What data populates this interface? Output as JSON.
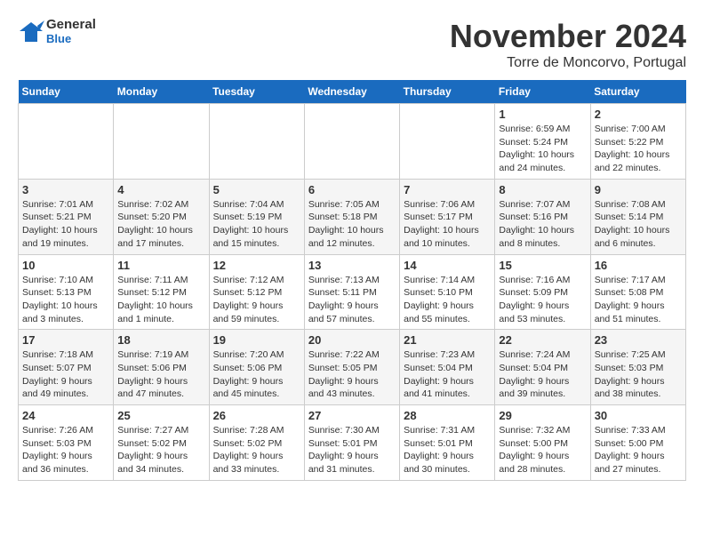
{
  "header": {
    "logo_line1": "General",
    "logo_line2": "Blue",
    "month_title": "November 2024",
    "subtitle": "Torre de Moncorvo, Portugal"
  },
  "weekdays": [
    "Sunday",
    "Monday",
    "Tuesday",
    "Wednesday",
    "Thursday",
    "Friday",
    "Saturday"
  ],
  "weeks": [
    [
      {
        "day": "",
        "info": ""
      },
      {
        "day": "",
        "info": ""
      },
      {
        "day": "",
        "info": ""
      },
      {
        "day": "",
        "info": ""
      },
      {
        "day": "",
        "info": ""
      },
      {
        "day": "1",
        "info": "Sunrise: 6:59 AM\nSunset: 5:24 PM\nDaylight: 10 hours\nand 24 minutes."
      },
      {
        "day": "2",
        "info": "Sunrise: 7:00 AM\nSunset: 5:22 PM\nDaylight: 10 hours\nand 22 minutes."
      }
    ],
    [
      {
        "day": "3",
        "info": "Sunrise: 7:01 AM\nSunset: 5:21 PM\nDaylight: 10 hours\nand 19 minutes."
      },
      {
        "day": "4",
        "info": "Sunrise: 7:02 AM\nSunset: 5:20 PM\nDaylight: 10 hours\nand 17 minutes."
      },
      {
        "day": "5",
        "info": "Sunrise: 7:04 AM\nSunset: 5:19 PM\nDaylight: 10 hours\nand 15 minutes."
      },
      {
        "day": "6",
        "info": "Sunrise: 7:05 AM\nSunset: 5:18 PM\nDaylight: 10 hours\nand 12 minutes."
      },
      {
        "day": "7",
        "info": "Sunrise: 7:06 AM\nSunset: 5:17 PM\nDaylight: 10 hours\nand 10 minutes."
      },
      {
        "day": "8",
        "info": "Sunrise: 7:07 AM\nSunset: 5:16 PM\nDaylight: 10 hours\nand 8 minutes."
      },
      {
        "day": "9",
        "info": "Sunrise: 7:08 AM\nSunset: 5:14 PM\nDaylight: 10 hours\nand 6 minutes."
      }
    ],
    [
      {
        "day": "10",
        "info": "Sunrise: 7:10 AM\nSunset: 5:13 PM\nDaylight: 10 hours\nand 3 minutes."
      },
      {
        "day": "11",
        "info": "Sunrise: 7:11 AM\nSunset: 5:12 PM\nDaylight: 10 hours\nand 1 minute."
      },
      {
        "day": "12",
        "info": "Sunrise: 7:12 AM\nSunset: 5:12 PM\nDaylight: 9 hours\nand 59 minutes."
      },
      {
        "day": "13",
        "info": "Sunrise: 7:13 AM\nSunset: 5:11 PM\nDaylight: 9 hours\nand 57 minutes."
      },
      {
        "day": "14",
        "info": "Sunrise: 7:14 AM\nSunset: 5:10 PM\nDaylight: 9 hours\nand 55 minutes."
      },
      {
        "day": "15",
        "info": "Sunrise: 7:16 AM\nSunset: 5:09 PM\nDaylight: 9 hours\nand 53 minutes."
      },
      {
        "day": "16",
        "info": "Sunrise: 7:17 AM\nSunset: 5:08 PM\nDaylight: 9 hours\nand 51 minutes."
      }
    ],
    [
      {
        "day": "17",
        "info": "Sunrise: 7:18 AM\nSunset: 5:07 PM\nDaylight: 9 hours\nand 49 minutes."
      },
      {
        "day": "18",
        "info": "Sunrise: 7:19 AM\nSunset: 5:06 PM\nDaylight: 9 hours\nand 47 minutes."
      },
      {
        "day": "19",
        "info": "Sunrise: 7:20 AM\nSunset: 5:06 PM\nDaylight: 9 hours\nand 45 minutes."
      },
      {
        "day": "20",
        "info": "Sunrise: 7:22 AM\nSunset: 5:05 PM\nDaylight: 9 hours\nand 43 minutes."
      },
      {
        "day": "21",
        "info": "Sunrise: 7:23 AM\nSunset: 5:04 PM\nDaylight: 9 hours\nand 41 minutes."
      },
      {
        "day": "22",
        "info": "Sunrise: 7:24 AM\nSunset: 5:04 PM\nDaylight: 9 hours\nand 39 minutes."
      },
      {
        "day": "23",
        "info": "Sunrise: 7:25 AM\nSunset: 5:03 PM\nDaylight: 9 hours\nand 38 minutes."
      }
    ],
    [
      {
        "day": "24",
        "info": "Sunrise: 7:26 AM\nSunset: 5:03 PM\nDaylight: 9 hours\nand 36 minutes."
      },
      {
        "day": "25",
        "info": "Sunrise: 7:27 AM\nSunset: 5:02 PM\nDaylight: 9 hours\nand 34 minutes."
      },
      {
        "day": "26",
        "info": "Sunrise: 7:28 AM\nSunset: 5:02 PM\nDaylight: 9 hours\nand 33 minutes."
      },
      {
        "day": "27",
        "info": "Sunrise: 7:30 AM\nSunset: 5:01 PM\nDaylight: 9 hours\nand 31 minutes."
      },
      {
        "day": "28",
        "info": "Sunrise: 7:31 AM\nSunset: 5:01 PM\nDaylight: 9 hours\nand 30 minutes."
      },
      {
        "day": "29",
        "info": "Sunrise: 7:32 AM\nSunset: 5:00 PM\nDaylight: 9 hours\nand 28 minutes."
      },
      {
        "day": "30",
        "info": "Sunrise: 7:33 AM\nSunset: 5:00 PM\nDaylight: 9 hours\nand 27 minutes."
      }
    ]
  ]
}
